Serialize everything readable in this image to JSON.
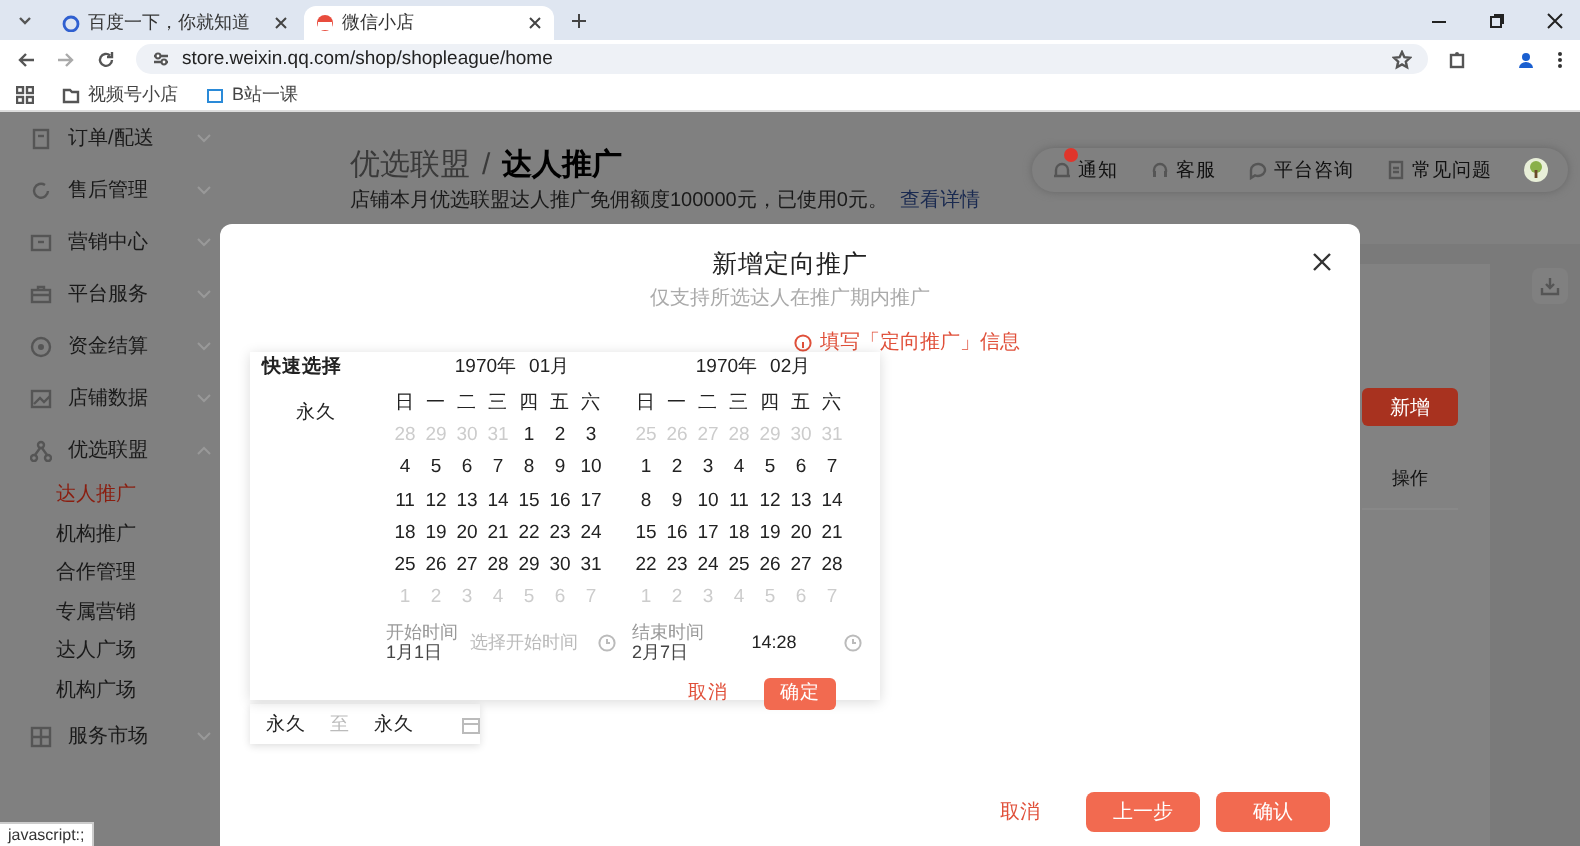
{
  "browser": {
    "tabs": [
      {
        "title": "百度一下，你就知道",
        "selected": false
      },
      {
        "title": "微信小店",
        "selected": true
      }
    ],
    "url": "store.weixin.qq.com/shop/shopleague/home",
    "bookmarks": [
      "视频号小店",
      "B站一课"
    ]
  },
  "sidebar": {
    "items": [
      {
        "label": "订单/配送",
        "expanded": false
      },
      {
        "label": "售后管理",
        "expanded": false
      },
      {
        "label": "营销中心",
        "expanded": false
      },
      {
        "label": "平台服务",
        "expanded": false
      },
      {
        "label": "资金结算",
        "expanded": false
      },
      {
        "label": "店铺数据",
        "expanded": false
      },
      {
        "label": "优选联盟",
        "expanded": true,
        "children": [
          {
            "label": "达人推广",
            "selected": true
          },
          {
            "label": "机构推广",
            "selected": false
          },
          {
            "label": "合作管理",
            "selected": false
          },
          {
            "label": "专属营销",
            "selected": false
          },
          {
            "label": "达人广场",
            "selected": false
          },
          {
            "label": "机构广场",
            "selected": false
          }
        ]
      },
      {
        "label": "服务市场",
        "expanded": false
      }
    ]
  },
  "header": {
    "breadcrumb": [
      "优选联盟",
      "达人推广"
    ],
    "breadcrumb_separator": "/",
    "notice": "店铺本月优选联盟达人推广免佣额度100000元，已使用0元。",
    "notice_link": "查看详情",
    "actions": [
      {
        "label": "通知",
        "unread": true
      },
      {
        "label": "客服",
        "unread": false
      },
      {
        "label": "平台咨询",
        "unread": false
      },
      {
        "label": "常见问题",
        "unread": false
      }
    ]
  },
  "content": {
    "add_button": "新增",
    "column": "操作"
  },
  "dialog": {
    "title": "新增定向推广",
    "subtitle": "仅支持所选达人在推广期内推广",
    "info": "填写「定向推广」信息",
    "date_range": {
      "start": "永久",
      "separator": "至",
      "end": "永久"
    },
    "buttons": [
      {
        "label": "取消",
        "kind": "text"
      },
      {
        "label": "上一步",
        "kind": "primary"
      },
      {
        "label": "确认",
        "kind": "primary"
      }
    ]
  },
  "date_picker": {
    "quick_title": "快速选择",
    "quick_options": [
      "永久"
    ],
    "months": [
      {
        "year": "1970年",
        "month": "01月",
        "weekdays": [
          "日",
          "一",
          "二",
          "三",
          "四",
          "五",
          "六"
        ],
        "days": [
          {
            "n": "28",
            "muted": true
          },
          {
            "n": "29",
            "muted": true
          },
          {
            "n": "30",
            "muted": true
          },
          {
            "n": "31",
            "muted": true
          },
          {
            "n": "1",
            "muted": false
          },
          {
            "n": "2",
            "muted": false
          },
          {
            "n": "3",
            "muted": false
          },
          {
            "n": "4",
            "muted": false
          },
          {
            "n": "5",
            "muted": false
          },
          {
            "n": "6",
            "muted": false
          },
          {
            "n": "7",
            "muted": false
          },
          {
            "n": "8",
            "muted": false
          },
          {
            "n": "9",
            "muted": false
          },
          {
            "n": "10",
            "muted": false
          },
          {
            "n": "11",
            "muted": false
          },
          {
            "n": "12",
            "muted": false
          },
          {
            "n": "13",
            "muted": false
          },
          {
            "n": "14",
            "muted": false
          },
          {
            "n": "15",
            "muted": false
          },
          {
            "n": "16",
            "muted": false
          },
          {
            "n": "17",
            "muted": false
          },
          {
            "n": "18",
            "muted": false
          },
          {
            "n": "19",
            "muted": false
          },
          {
            "n": "20",
            "muted": false
          },
          {
            "n": "21",
            "muted": false
          },
          {
            "n": "22",
            "muted": false
          },
          {
            "n": "23",
            "muted": false
          },
          {
            "n": "24",
            "muted": false
          },
          {
            "n": "25",
            "muted": false
          },
          {
            "n": "26",
            "muted": false
          },
          {
            "n": "27",
            "muted": false
          },
          {
            "n": "28",
            "muted": false
          },
          {
            "n": "29",
            "muted": false
          },
          {
            "n": "30",
            "muted": false
          },
          {
            "n": "31",
            "muted": false
          },
          {
            "n": "1",
            "muted": true
          },
          {
            "n": "2",
            "muted": true
          },
          {
            "n": "3",
            "muted": true
          },
          {
            "n": "4",
            "muted": true
          },
          {
            "n": "5",
            "muted": true
          },
          {
            "n": "6",
            "muted": true
          },
          {
            "n": "7",
            "muted": true
          }
        ]
      },
      {
        "year": "1970年",
        "month": "02月",
        "weekdays": [
          "日",
          "一",
          "二",
          "三",
          "四",
          "五",
          "六"
        ],
        "days": [
          {
            "n": "25",
            "muted": true
          },
          {
            "n": "26",
            "muted": true
          },
          {
            "n": "27",
            "muted": true
          },
          {
            "n": "28",
            "muted": true
          },
          {
            "n": "29",
            "muted": true
          },
          {
            "n": "30",
            "muted": true
          },
          {
            "n": "31",
            "muted": true
          },
          {
            "n": "1",
            "muted": false
          },
          {
            "n": "2",
            "muted": false
          },
          {
            "n": "3",
            "muted": false
          },
          {
            "n": "4",
            "muted": false
          },
          {
            "n": "5",
            "muted": false
          },
          {
            "n": "6",
            "muted": false
          },
          {
            "n": "7",
            "muted": false
          },
          {
            "n": "8",
            "muted": false
          },
          {
            "n": "9",
            "muted": false
          },
          {
            "n": "10",
            "muted": false
          },
          {
            "n": "11",
            "muted": false
          },
          {
            "n": "12",
            "muted": false
          },
          {
            "n": "13",
            "muted": false
          },
          {
            "n": "14",
            "muted": false
          },
          {
            "n": "15",
            "muted": false
          },
          {
            "n": "16",
            "muted": false
          },
          {
            "n": "17",
            "muted": false
          },
          {
            "n": "18",
            "muted": false
          },
          {
            "n": "19",
            "muted": false
          },
          {
            "n": "20",
            "muted": false
          },
          {
            "n": "21",
            "muted": false
          },
          {
            "n": "22",
            "muted": false
          },
          {
            "n": "23",
            "muted": false
          },
          {
            "n": "24",
            "muted": false
          },
          {
            "n": "25",
            "muted": false
          },
          {
            "n": "26",
            "muted": false
          },
          {
            "n": "27",
            "muted": false
          },
          {
            "n": "28",
            "muted": false
          },
          {
            "n": "1",
            "muted": true
          },
          {
            "n": "2",
            "muted": true
          },
          {
            "n": "3",
            "muted": true
          },
          {
            "n": "4",
            "muted": true
          },
          {
            "n": "5",
            "muted": true
          },
          {
            "n": "6",
            "muted": true
          },
          {
            "n": "7",
            "muted": true
          }
        ]
      }
    ],
    "start": {
      "label": "开始时间",
      "date": "1月1日",
      "placeholder": "选择开始时间"
    },
    "end": {
      "label": "结束时间",
      "date": "2月7日",
      "time": "14:28"
    },
    "buttons": [
      {
        "label": "取消",
        "kind": "text"
      },
      {
        "label": "确定",
        "kind": "primary"
      }
    ]
  },
  "status_bar": "javascript:;"
}
